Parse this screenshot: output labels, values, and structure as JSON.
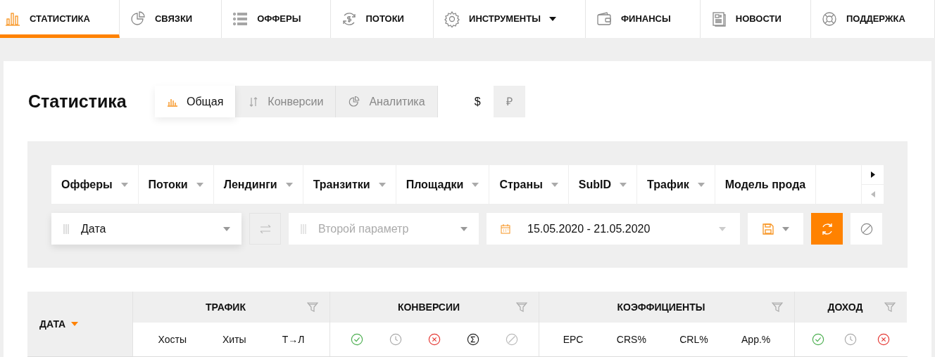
{
  "nav": [
    {
      "label": "СТАТИСТИКА",
      "kind": "chart",
      "selected": true
    },
    {
      "label": "СВЯЗКИ",
      "kind": "pie",
      "selected": false
    },
    {
      "label": "ОФФЕРЫ",
      "kind": "list",
      "selected": false
    },
    {
      "label": "ПОТОКИ",
      "kind": "money",
      "selected": false
    },
    {
      "label": "ИНСТРУМЕНТЫ",
      "kind": "gear",
      "selected": false,
      "dropdown": true
    },
    {
      "label": "ФИНАНСЫ",
      "kind": "wallet",
      "selected": false
    },
    {
      "label": "НОВОСТИ",
      "kind": "news",
      "selected": false
    },
    {
      "label": "ПОДДЕРЖКА",
      "kind": "lifebuoy",
      "selected": false
    }
  ],
  "page_title": "Статистика",
  "view_tabs": [
    {
      "label": "Общая",
      "kind": "bars",
      "selected": true
    },
    {
      "label": "Конверсии",
      "kind": "arrows",
      "selected": false
    },
    {
      "label": "Аналитика",
      "kind": "pie",
      "selected": false
    }
  ],
  "currency": [
    {
      "label": "$",
      "selected": true
    },
    {
      "label": "₽",
      "selected": false
    }
  ],
  "group_tabs": [
    {
      "label": "Офферы",
      "dropdown": true
    },
    {
      "label": "Потоки",
      "dropdown": true
    },
    {
      "label": "Лендинги",
      "dropdown": true
    },
    {
      "label": "Транзитки",
      "dropdown": true
    },
    {
      "label": "Площадки",
      "dropdown": true
    },
    {
      "label": "Страны",
      "dropdown": true
    },
    {
      "label": "SubID",
      "dropdown": true
    },
    {
      "label": "Трафик",
      "dropdown": true
    },
    {
      "label": "Модель прода",
      "dropdown": false
    }
  ],
  "filters": {
    "first_param": "Дата",
    "second_param_placeholder": "Второй параметр",
    "date_range": "15.05.2020 - 21.05.2020"
  },
  "table": {
    "date_column": {
      "label": "ДАТА",
      "sorted": true
    },
    "groups": [
      {
        "label": "ТРАФИК",
        "columns": [
          {
            "kind": "text",
            "label": "Хосты"
          },
          {
            "kind": "text",
            "label": "Хиты"
          },
          {
            "kind": "text",
            "label": "Т→Л"
          }
        ]
      },
      {
        "label": "КОНВЕРСИИ",
        "columns": [
          {
            "kind": "approved"
          },
          {
            "kind": "pending"
          },
          {
            "kind": "rejected"
          },
          {
            "kind": "total"
          },
          {
            "kind": "blocked"
          }
        ]
      },
      {
        "label": "КОЭФФИЦИЕНТЫ",
        "columns": [
          {
            "kind": "text",
            "label": "EPC"
          },
          {
            "kind": "text",
            "label": "CRS%"
          },
          {
            "kind": "text",
            "label": "CRL%"
          },
          {
            "kind": "text",
            "label": "App.%"
          }
        ]
      },
      {
        "label": "ДОХОД",
        "columns": [
          {
            "kind": "approved"
          },
          {
            "kind": "pending"
          },
          {
            "kind": "rejected"
          }
        ]
      }
    ]
  }
}
